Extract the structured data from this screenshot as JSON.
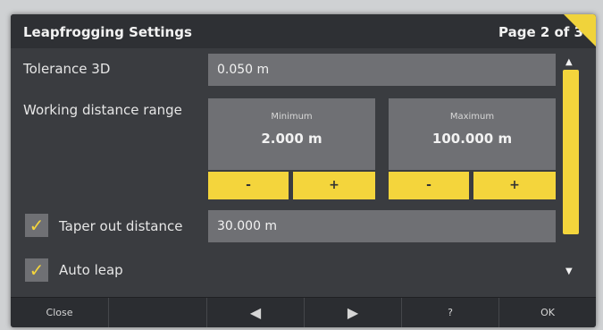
{
  "header": {
    "title": "Leapfrogging Settings",
    "page": "Page 2 of 3"
  },
  "tolerance": {
    "label": "Tolerance 3D",
    "value": "0.050 m"
  },
  "working_distance": {
    "label": "Working distance range",
    "minimum": {
      "caption": "Minimum",
      "value": "2.000 m",
      "minus": "-",
      "plus": "+"
    },
    "maximum": {
      "caption": "Maximum",
      "value": "100.000 m",
      "minus": "-",
      "plus": "+"
    }
  },
  "taper": {
    "label": "Taper out distance",
    "value": "30.000 m",
    "checked": true,
    "check_glyph": "✓"
  },
  "auto_leap": {
    "label": "Auto leap",
    "checked": true,
    "check_glyph": "✓"
  },
  "scroll": {
    "up_glyph": "▲",
    "down_glyph": "▼"
  },
  "footer": {
    "close": "Close",
    "prev_glyph": "◀",
    "next_glyph": "▶",
    "help": "?",
    "ok": "OK"
  },
  "colors": {
    "accent": "#f4d53c",
    "field": "#6f7074",
    "background": "#3a3c40"
  }
}
